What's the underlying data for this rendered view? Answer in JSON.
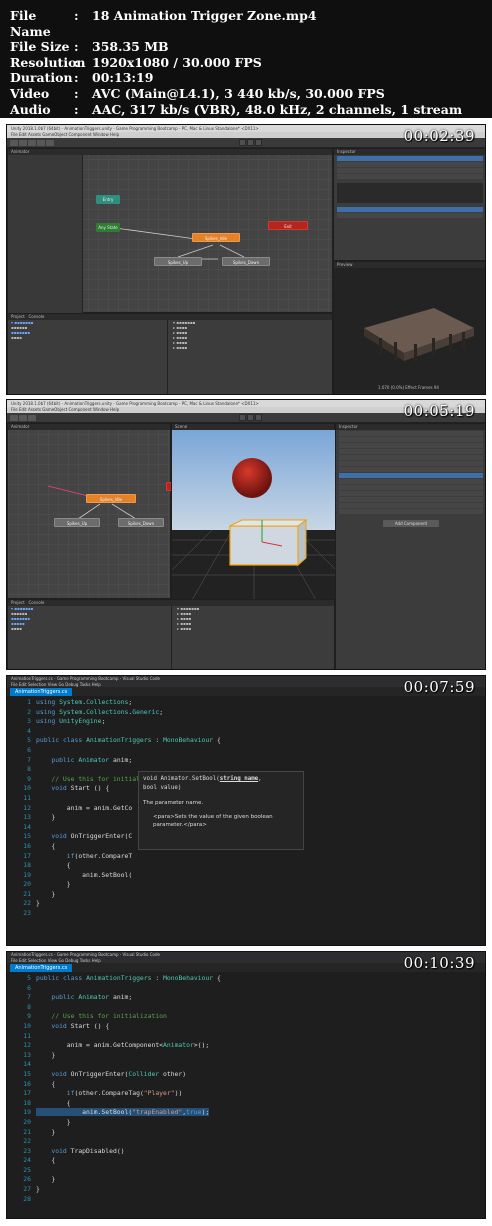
{
  "info": [
    {
      "key": "File Name",
      "value": "18 Animation Trigger Zone.mp4"
    },
    {
      "key": "File Size",
      "value": "358.35 MB"
    },
    {
      "key": "Resolution",
      "value": "1920x1080 / 30.000 FPS"
    },
    {
      "key": "Duration",
      "value": "00:13:19"
    },
    {
      "key": "Video",
      "value": "AVC (Main@L4.1), 3 440 kb/s, 30.000 FPS"
    },
    {
      "key": "Audio",
      "value": "AAC, 317 kb/s (VBR), 48.0 kHz, 2 channels, 1 stream"
    }
  ],
  "frames": [
    {
      "timestamp": "00:02:39",
      "window_title": "Unity 2018.1.0b7 (64bit) - AnimationTriggers.unity - Game Programming Bootcamp - PC, Mac & Linux Standalone* <DX11>",
      "menu": "File   Edit   Assets   GameObject   Component   Window   Help",
      "animator_tab": "Animator",
      "animator_states": [
        "Entry",
        "Any State",
        "Spikes_Idle",
        "Exit",
        "Spikes_Up",
        "Spikes_Down"
      ],
      "project_tab": "Project",
      "console_tab": "Console",
      "inspector_tab": "Inspector",
      "preview_label": "Preview",
      "preview_caption": "1.070 (0.0%) Effect Frames 94"
    },
    {
      "timestamp": "00:05:19",
      "window_title": "Unity 2018.1.0b7 (64bit) - AnimationTriggers.unity - Game Programming Bootcamp - PC, Mac & Linux Standalone* <DX11>",
      "menu": "File   Edit   Assets   GameObject   Component   Window   Help",
      "animator_states": [
        "Spikes_Idle",
        "Spikes_Up",
        "Spikes_Down"
      ],
      "scene_tab": "Scene",
      "add_component": "Add Component"
    },
    {
      "timestamp": "00:07:59",
      "window_title": "AnimationTriggers.cs - Game Programming Bootcamp - Visual Studio Code",
      "menu": "File   Edit   Selection   View   Go   Debug   Tasks   Help",
      "tab": "AnimationTriggers.cs",
      "lines": [
        {
          "n": "1",
          "t": "using System.Collections;"
        },
        {
          "n": "2",
          "t": "using System.Collections.Generic;"
        },
        {
          "n": "3",
          "t": "using UnityEngine;"
        },
        {
          "n": "4",
          "t": ""
        },
        {
          "n": "5",
          "t": "public class AnimationTriggers : MonoBehaviour {"
        },
        {
          "n": "6",
          "t": ""
        },
        {
          "n": "7",
          "t": "    public Animator anim;"
        },
        {
          "n": "8",
          "t": ""
        },
        {
          "n": "9",
          "t": "    // Use this for initialization"
        },
        {
          "n": "10",
          "t": "    void Start () {"
        },
        {
          "n": "11",
          "t": ""
        },
        {
          "n": "12",
          "t": "        anim = anim.GetCo"
        },
        {
          "n": "13",
          "t": "    }"
        },
        {
          "n": "14",
          "t": ""
        },
        {
          "n": "15",
          "t": "    void OnTriggerEnter(C"
        },
        {
          "n": "16",
          "t": "    {"
        },
        {
          "n": "17",
          "t": "        if(other.CompareT"
        },
        {
          "n": "18",
          "t": "        {"
        },
        {
          "n": "19",
          "t": "            anim.SetBool("
        },
        {
          "n": "20",
          "t": "        }"
        },
        {
          "n": "21",
          "t": "    }"
        },
        {
          "n": "22",
          "t": "}"
        },
        {
          "n": "23",
          "t": ""
        }
      ],
      "tooltip": {
        "sig_pre": "void Animator.SetBool(",
        "sig_param": "string name",
        "sig_post": ",",
        "sig_line2": "bool value)",
        "param_desc": "The parameter name.",
        "para": "<para>Sets the value of the given boolean parameter.</para>"
      }
    },
    {
      "timestamp": "00:10:39",
      "window_title": "AnimationTriggers.cs - Game Programming Bootcamp - Visual Studio Code",
      "menu": "File   Edit   Selection   View   Go   Debug   Tasks   Help",
      "tab": "AnimationTriggers.cs",
      "lines": [
        {
          "n": "5",
          "t": "public class AnimationTriggers : MonoBehaviour {"
        },
        {
          "n": "6",
          "t": ""
        },
        {
          "n": "7",
          "t": "    public Animator anim;"
        },
        {
          "n": "8",
          "t": ""
        },
        {
          "n": "9",
          "t": "    // Use this for initialization"
        },
        {
          "n": "10",
          "t": "    void Start () {"
        },
        {
          "n": "11",
          "t": ""
        },
        {
          "n": "12",
          "t": "        anim = anim.GetComponent<Animator>();"
        },
        {
          "n": "13",
          "t": "    }"
        },
        {
          "n": "14",
          "t": ""
        },
        {
          "n": "15",
          "t": "    void OnTriggerEnter(Collider other)"
        },
        {
          "n": "16",
          "t": "    {"
        },
        {
          "n": "17",
          "t": "        if(other.CompareTag(\"Player\"))"
        },
        {
          "n": "18",
          "t": "        {"
        },
        {
          "n": "19",
          "t": "            anim.SetBool(\"trapEnabled\",true);"
        },
        {
          "n": "20",
          "t": "        }"
        },
        {
          "n": "21",
          "t": "    }"
        },
        {
          "n": "22",
          "t": ""
        },
        {
          "n": "23",
          "t": "    void TrapDisabled()"
        },
        {
          "n": "24",
          "t": "    {"
        },
        {
          "n": "25",
          "t": ""
        },
        {
          "n": "26",
          "t": "    }"
        },
        {
          "n": "27",
          "t": "}"
        },
        {
          "n": "28",
          "t": ""
        }
      ]
    }
  ]
}
